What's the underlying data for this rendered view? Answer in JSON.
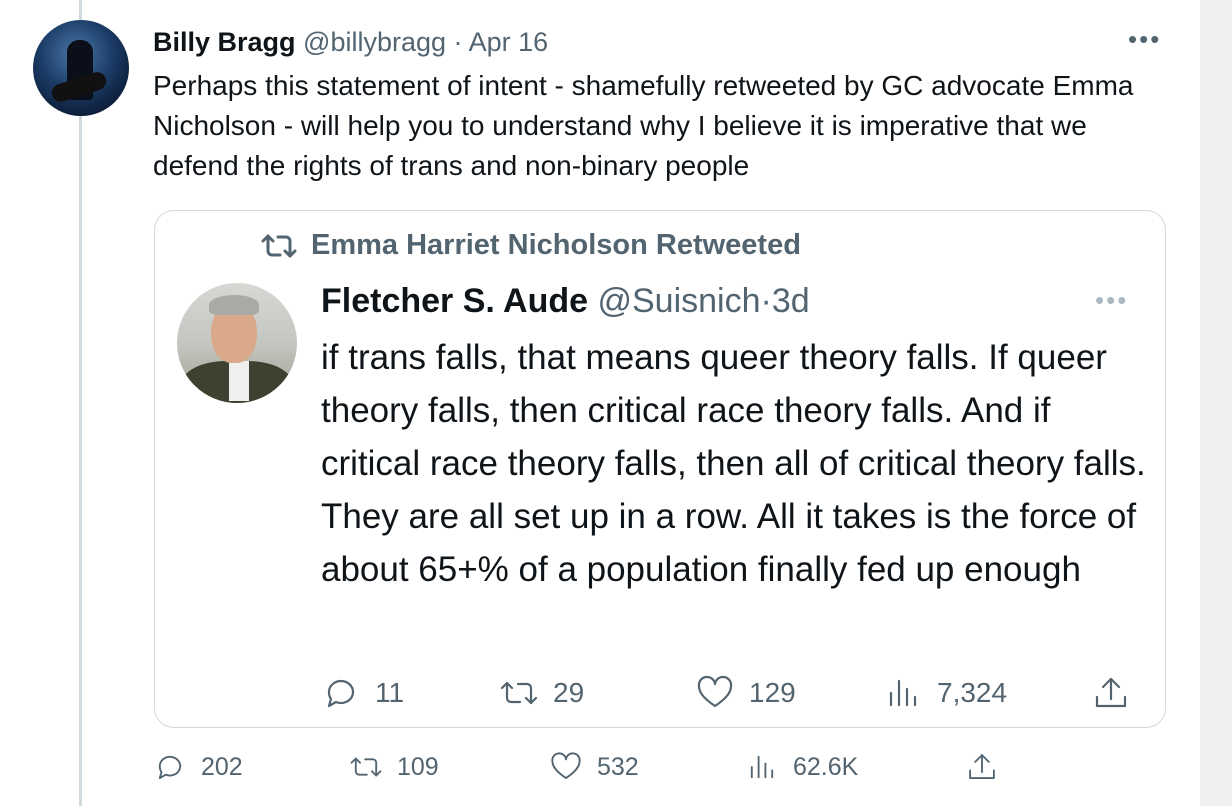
{
  "tweet": {
    "author_name": "Billy Bragg",
    "author_handle": "@billybragg",
    "date_separator": "·",
    "date": "Apr 16",
    "more_icon": "ellipsis-icon",
    "text": "Perhaps this statement of intent - shamefully retweeted by GC advocate Emma Nicholson - will help you to understand why I believe it is imperative that we defend the rights of trans and non-binary people",
    "actions": {
      "replies": "202",
      "retweets": "109",
      "likes": "532",
      "views": "62.6K"
    }
  },
  "quoted_tweet": {
    "retweeted_by": "Emma Harriet Nicholson Retweeted",
    "author_name": "Fletcher S. Aude",
    "author_handle": "@Suisnich",
    "date_separator": "·",
    "date": "3d",
    "text": "if trans falls, that means queer theory falls. If queer theory falls, then critical race theory falls. And if critical race theory falls, then all of critical theory falls. They are all set up in a row. All it takes is the force of about 65+% of a population finally fed up enough",
    "actions": {
      "replies": "11",
      "retweets": "29",
      "likes": "129",
      "views": "7,324"
    }
  },
  "colors": {
    "text": "#0f1419",
    "secondary": "#536471",
    "border": "#cfd9de"
  }
}
